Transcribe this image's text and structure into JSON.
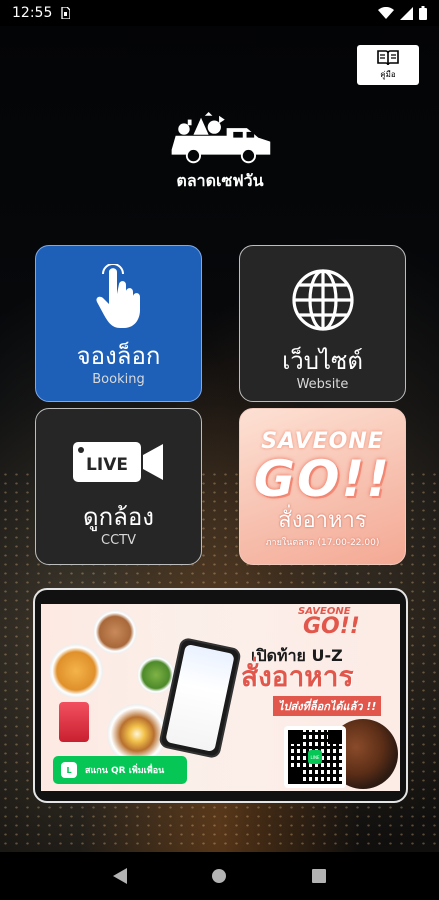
{
  "status_bar": {
    "time": "12:55",
    "sim_icon": "sim-icon"
  },
  "manual_button": {
    "label": "คู่มือ",
    "icon": "book-icon"
  },
  "logo": {
    "text": "ตลาดเซฟวัน",
    "icon": "truck-with-goods-icon"
  },
  "tiles": {
    "booking": {
      "title": "จองล็อก",
      "subtitle": "Booking",
      "icon": "tap-hand-icon",
      "color": "#1e5fb8"
    },
    "website": {
      "title": "เว็บไซต์",
      "subtitle": "Website",
      "icon": "globe-icon",
      "color": "#262626"
    },
    "cctv": {
      "title": "ดูกล้อง",
      "subtitle": "CCTV",
      "icon": "live-camera-icon",
      "live_label": "LIVE",
      "color": "#262626"
    },
    "order": {
      "brand_top": "SAVEONE",
      "brand_bottom": "GO!!",
      "title": "สั่งอาหาร",
      "subtitle": "ภายในตลาด (17.00-22.00)"
    }
  },
  "banner": {
    "brand_top": "SAVEONE",
    "brand_bottom": "GO!!",
    "headline1": "เปิดท้าย U-Z",
    "headline2": "สั่งอาหาร",
    "headline3": "ไปส่งที่ล็อกได้แล้ว !!",
    "line_button": "สแกน QR เพิ่มเพื่อน",
    "qr_badge": "LINE",
    "accent": "#e2574c",
    "line_green": "#06c755"
  },
  "nav": {
    "back_icon": "back-triangle-icon",
    "home_icon": "home-circle-icon",
    "recents_icon": "recents-square-icon"
  }
}
